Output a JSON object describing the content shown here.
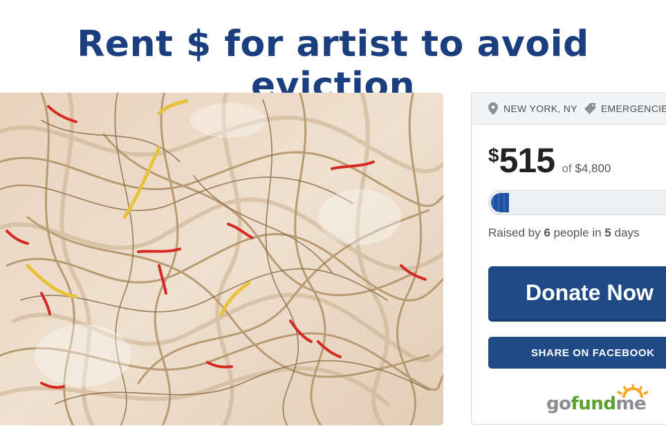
{
  "title": "Rent $ for artist to avoid eviction",
  "card": {
    "location": "NEW YORK, NY",
    "category": "EMERGENCIES",
    "currency_symbol": "$",
    "raised": "515",
    "goal_prefix": "of",
    "goal": "$4,800",
    "progress_fraction": 0.107,
    "stats": {
      "prefix": "Raised by",
      "people": "6",
      "middle": "people in",
      "days": "5",
      "suffix": "days"
    },
    "donate_label": "Donate Now",
    "facebook_label": "SHARE ON FACEBOOK",
    "logo": {
      "go": "go",
      "fund": "fund",
      "me": "me"
    }
  },
  "colors": {
    "brand_blue": "#1f4a86",
    "title_blue": "#1b3f7e",
    "logo_green": "#5aa02c",
    "logo_orange": "#f5a623"
  },
  "icons": [
    "location-pin-icon",
    "tag-icon",
    "sun-rays-icon"
  ]
}
